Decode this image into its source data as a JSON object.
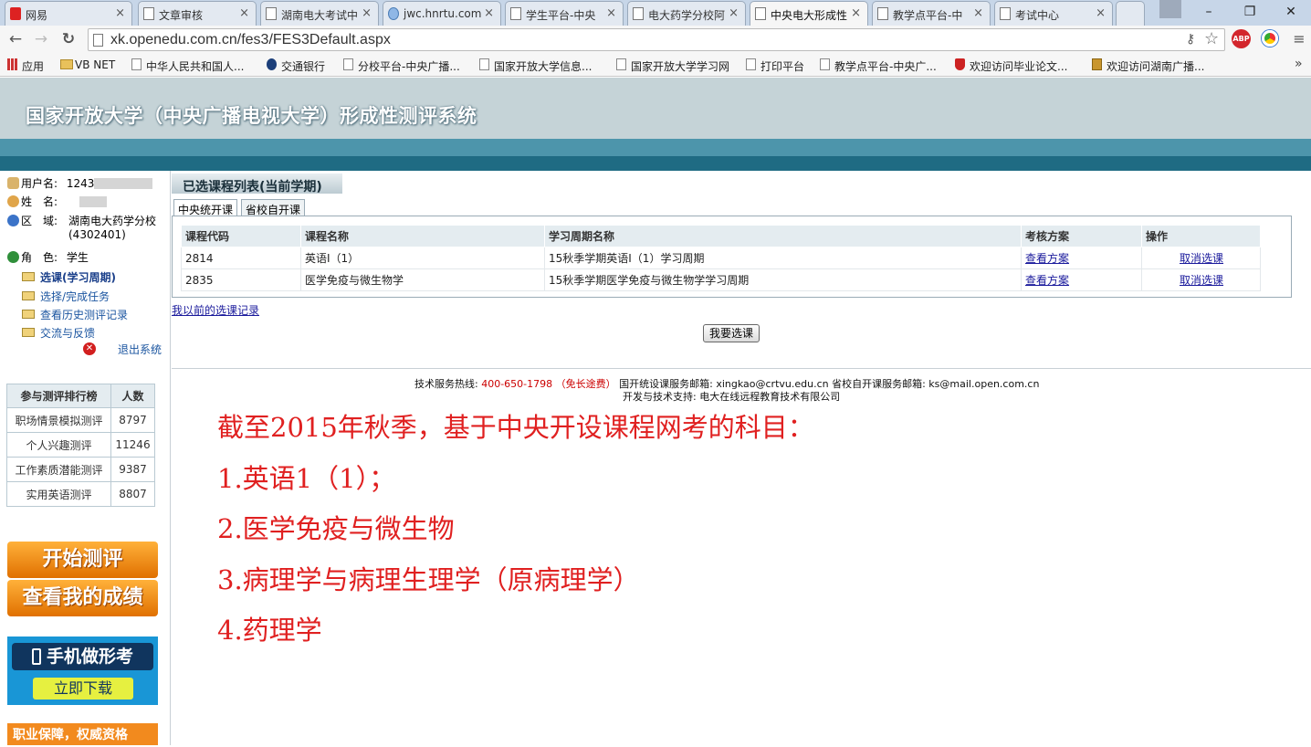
{
  "browser": {
    "tabs": [
      {
        "title": "网易"
      },
      {
        "title": "文章审核"
      },
      {
        "title": "湖南电大考试中"
      },
      {
        "title": "jwc.hnrtu.com"
      },
      {
        "title": "学生平台-中央"
      },
      {
        "title": "电大药学分校阿"
      },
      {
        "title": "中央电大形成性"
      },
      {
        "title": "教学点平台-中"
      },
      {
        "title": "考试中心"
      }
    ],
    "window_controls": {
      "minimize": "–",
      "maximize": "❐",
      "close": "✕"
    },
    "url": "xk.openedu.com.cn/fes3/FES3Default.aspx",
    "bookmarks": [
      {
        "label": "应用"
      },
      {
        "label": "VB NET"
      },
      {
        "label": "中华人民共和国人..."
      },
      {
        "label": "交通银行"
      },
      {
        "label": "分校平台-中央广播..."
      },
      {
        "label": "国家开放大学信息..."
      },
      {
        "label": "国家开放大学学习网"
      },
      {
        "label": "打印平台"
      },
      {
        "label": "教学点平台-中央广..."
      },
      {
        "label": "欢迎访问毕业论文..."
      },
      {
        "label": "欢迎访问湖南广播..."
      }
    ],
    "bookmarks_overflow": "»",
    "extension_label": "ABP"
  },
  "site": {
    "title": "国家开放大学（中央广播电视大学）形成性测评系统"
  },
  "user": {
    "username_label": "用户名:",
    "username_value": "1243",
    "name_label": "姓　名:",
    "region_label": "区　域:",
    "region_value": "湖南电大药学分校",
    "region_code": "(4302401)",
    "role_label": "角　色:",
    "role_value": "学生"
  },
  "menu": {
    "items": [
      {
        "label": "选课(学习周期)"
      },
      {
        "label": "选择/完成任务"
      },
      {
        "label": "查看历史测评记录"
      },
      {
        "label": "交流与反馈"
      }
    ],
    "logout": "退出系统"
  },
  "ranking": {
    "headers": [
      "参与测评排行榜",
      "人数"
    ],
    "rows": [
      {
        "name": "职场情景模拟测评",
        "count": "8797"
      },
      {
        "name": "个人兴趣测评",
        "count": "11246"
      },
      {
        "name": "工作素质潜能测评",
        "count": "9387"
      },
      {
        "name": "实用英语测评",
        "count": "8807"
      }
    ]
  },
  "promos": {
    "start": "开始测评",
    "scores": "查看我的成绩",
    "mobile": "手机做形考",
    "download": "立即下载",
    "career": "职业保障，权威资格"
  },
  "main": {
    "section_title": "已选课程列表(当前学期)",
    "tabs": [
      {
        "label": "中央统开课"
      },
      {
        "label": "省校自开课"
      }
    ],
    "table": {
      "headers": [
        "课程代码",
        "课程名称",
        "学习周期名称",
        "考核方案",
        "操作"
      ],
      "rows": [
        {
          "code": "2814",
          "name": "英语I（1）",
          "period": "15秋季学期英语I（1）学习周期",
          "plan": "查看方案",
          "action": "取消选课"
        },
        {
          "code": "2835",
          "name": "医学免疫与微生物学",
          "period": "15秋季学期医学免疫与微生物学学习周期",
          "plan": "查看方案",
          "action": "取消选课"
        }
      ]
    },
    "history_link": "我以前的选课记录",
    "select_button": "我要选课"
  },
  "footer": {
    "hotline_label": "技术服务热线:",
    "hotline_number": "400-650-1798 （免长途费）",
    "email1": "国开统设课服务邮箱: xingkao@crtvu.edu.cn",
    "email2": "省校自开课服务邮箱: ks@mail.open.com.cn",
    "support": "开发与技术支持: 电大在线远程教育技术有限公司"
  },
  "annotation": {
    "lines": [
      "截至2015年秋季，基于中央开设课程网考的科目：",
      "1.英语1（1）；",
      "2.医学免疫与微生物",
      "3.病理学与病理生理学（原病理学）",
      "4.药理学"
    ],
    "color": "#e02020"
  }
}
